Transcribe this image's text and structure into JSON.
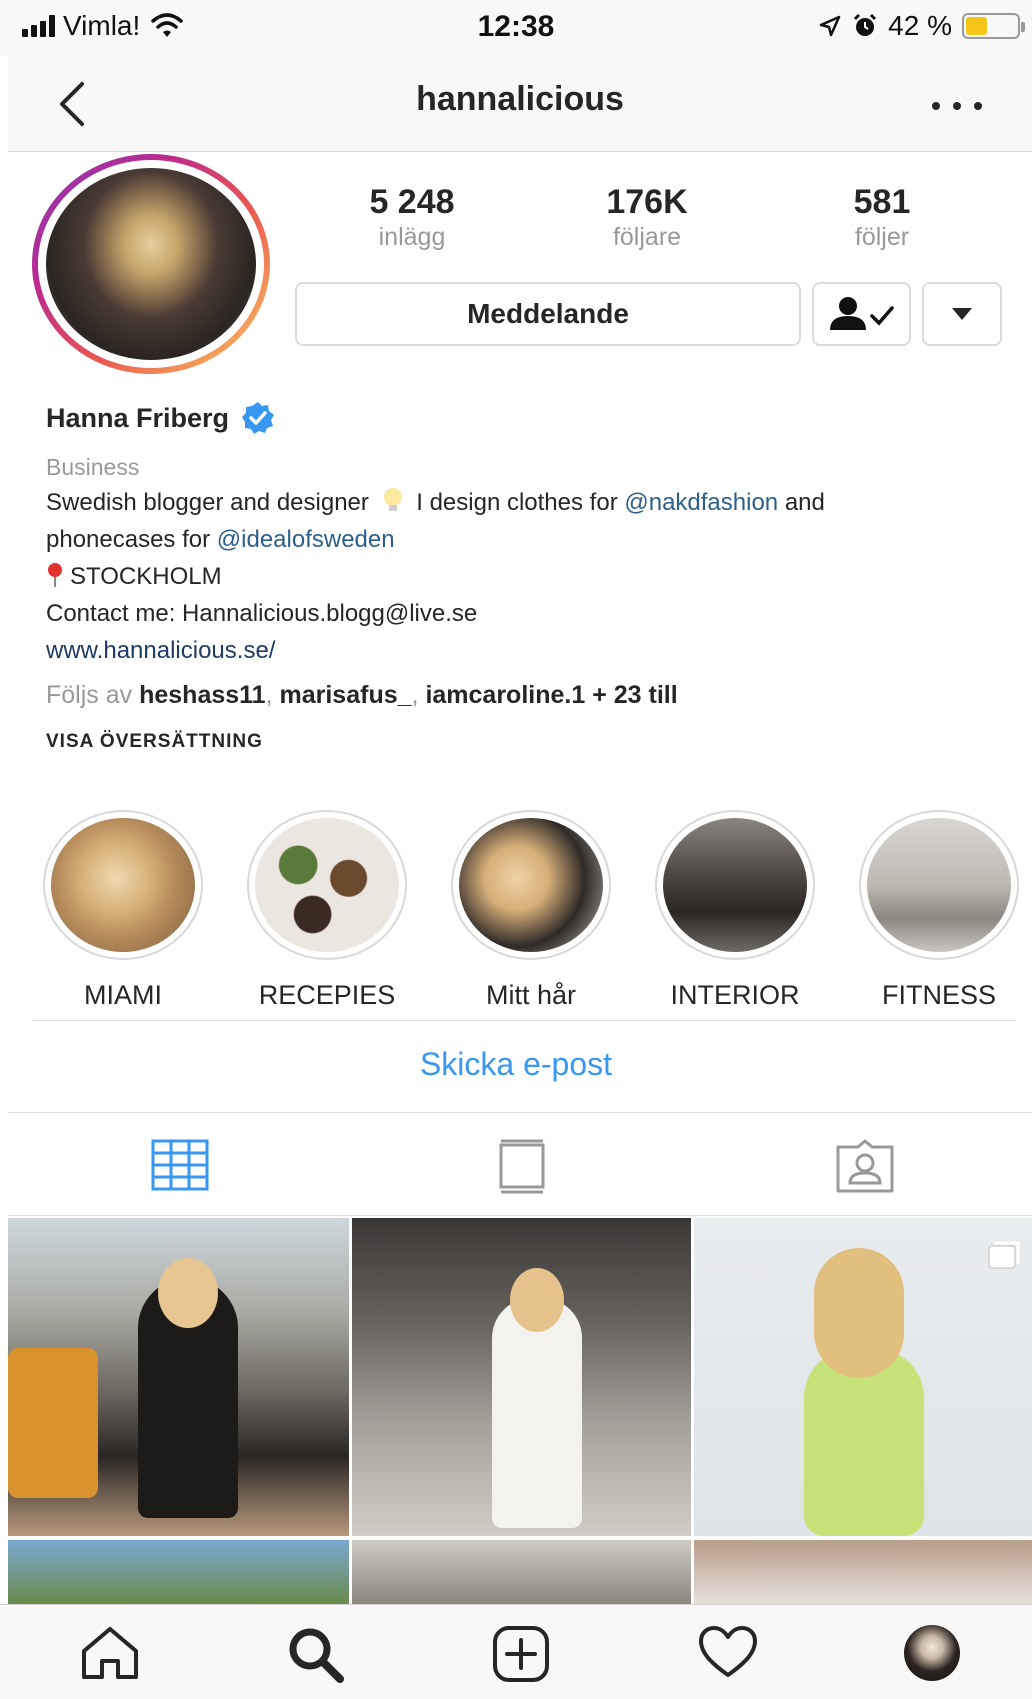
{
  "status_bar": {
    "carrier": "Vimla!",
    "time": "12:38",
    "battery_percent": "42 %",
    "battery_level": 0.42
  },
  "nav": {
    "title": "hannalicious"
  },
  "profile": {
    "stats": [
      {
        "value": "5 248",
        "label": "inlägg"
      },
      {
        "value": "176K",
        "label": "följare"
      },
      {
        "value": "581",
        "label": "följer"
      }
    ],
    "message_button": "Meddelande"
  },
  "bio": {
    "name": "Hanna Friberg",
    "category": "Business",
    "line1_a": "Swedish blogger and designer",
    "line1_b": "I design clothes for",
    "mention1": "@nakdfashion",
    "line1_c": "and",
    "line2_a": "phonecases for",
    "mention2": "@idealofsweden",
    "location": "STOCKHOLM",
    "contact": "Contact me: Hannalicious.blogg@live.se",
    "website": "www.hannalicious.se/",
    "followed_prefix": "Följs av",
    "followers": [
      "heshass11",
      "marisafus_",
      "iamcaroline.1"
    ],
    "followed_suffix": "+ 23 till",
    "translate": "VISA ÖVERSÄTTNING"
  },
  "highlights": [
    {
      "label": "MIAMI"
    },
    {
      "label": "RECEPIES"
    },
    {
      "label": "Mitt hår"
    },
    {
      "label": "INTERIOR"
    },
    {
      "label": "FITNESS"
    }
  ],
  "email_link": "Skicka e-post",
  "icons": {
    "back": "chevron-left-icon",
    "more": "more-horizontal-icon",
    "following": "person-check-icon",
    "dropdown": "caret-down-icon",
    "verified": "verified-badge-icon",
    "grid_tab": "grid-icon",
    "feed_tab": "feed-icon",
    "tagged_tab": "tagged-person-icon",
    "home": "home-icon",
    "search": "search-icon",
    "add": "add-post-icon",
    "activity": "heart-icon"
  },
  "colors": {
    "link_blue": "#3897f0",
    "mention_blue": "#2c5f8a",
    "verified_blue": "#3897f0",
    "battery_yellow": "#f5c518"
  }
}
